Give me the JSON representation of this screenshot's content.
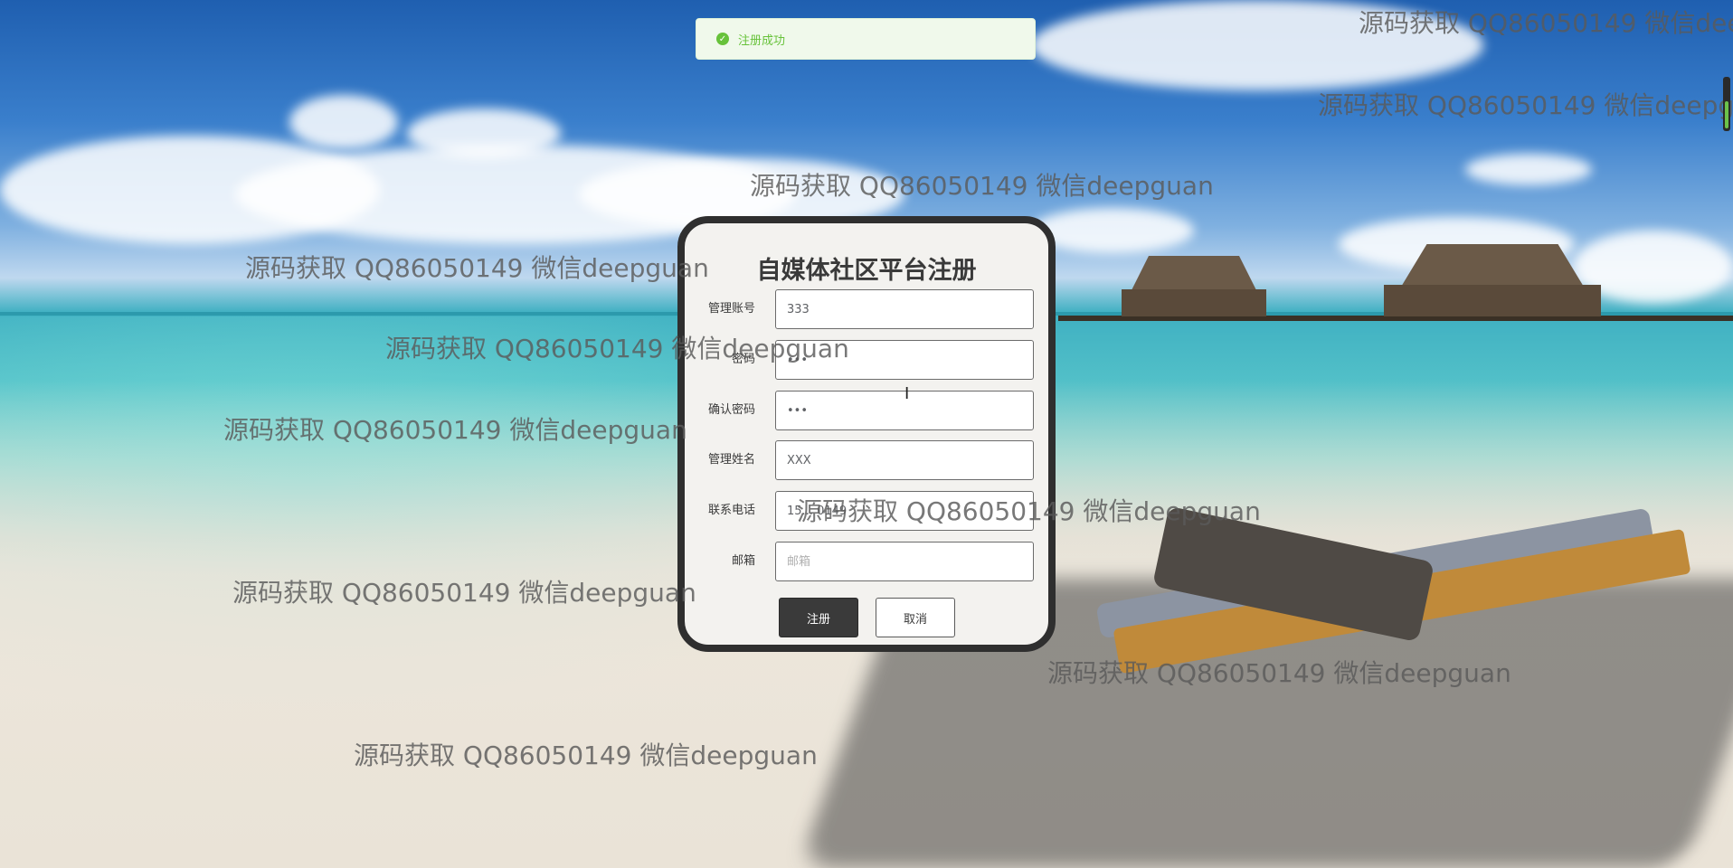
{
  "toast": {
    "message": "注册成功",
    "icon": "check-circle-icon",
    "color": "#67c23a"
  },
  "form": {
    "title": "自媒体社区平台注册",
    "fields": [
      {
        "label": "管理账号",
        "value": "333",
        "placeholder": "",
        "type": "text"
      },
      {
        "label": "密码",
        "value": "•••",
        "placeholder": "",
        "type": "password"
      },
      {
        "label": "确认密码",
        "value": "•••",
        "placeholder": "",
        "type": "password"
      },
      {
        "label": "管理姓名",
        "value": "XXX",
        "placeholder": "",
        "type": "text"
      },
      {
        "label": "联系电话",
        "value": "15... 0149",
        "placeholder": "",
        "type": "text"
      },
      {
        "label": "邮箱",
        "value": "",
        "placeholder": "邮箱",
        "type": "text"
      }
    ],
    "register_label": "注册",
    "cancel_label": "取消"
  },
  "watermarks": [
    "源码获取 QQ86050149 微信deepguan",
    "源码获取 QQ86050149 微信deepguan",
    "源码获取 QQ86050149 微信deepguan",
    "源码获取 QQ86050149 微信deepguan",
    "源码获取 QQ86050149 微信deepguan",
    "源码获取 QQ86050149 微信deepguan",
    "源码获取 QQ86050149 微信deepguan",
    "源码获取 QQ86050149 微信deepguan",
    "源码获取 QQ86050149 微信deepguan",
    "源码获取 QQ86050149 微信deepguan"
  ]
}
